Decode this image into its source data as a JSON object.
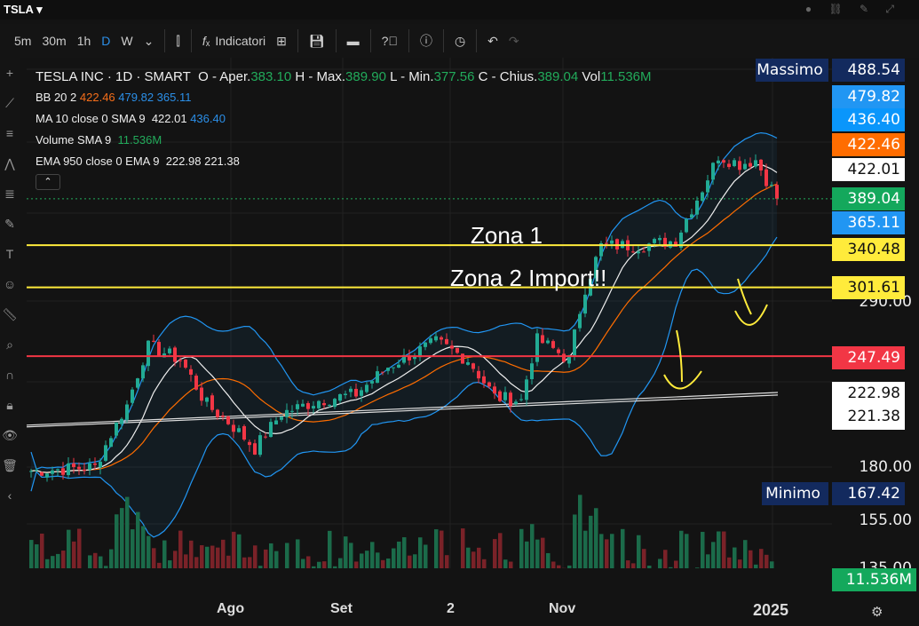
{
  "topbar": {
    "symbol": "TSLA ▾"
  },
  "toolbar": {
    "intervals": [
      "5m",
      "30m",
      "1h",
      "D",
      "W"
    ],
    "active": "D",
    "indicators": "Indicatori"
  },
  "legend": {
    "title": "TESLA INC · 1D · SMART",
    "o_label": "O - Aper.",
    "o": "383.10",
    "h_label": "H - Max.",
    "h": "389.90",
    "l_label": "L - Min.",
    "l": "377.56",
    "c_label": "C - Chius.",
    "c": "389.04",
    "vol_label": "Vol",
    "vol": "11.536M",
    "bb_label": "BB 20 2",
    "bb_mid": "422.46",
    "bb_up": "479.82",
    "bb_lo": "365.11",
    "ma_label": "MA 10 close 0 SMA 9",
    "ma": "422.01",
    "ma_sma": "436.40",
    "volsma_label": "Volume SMA 9",
    "volsma": "11.536M",
    "ema_label": "EMA 950 close 0 EMA 9",
    "ema": "222.98",
    "ema2": "221.38"
  },
  "annotations": {
    "zona1": "Zona 1",
    "zona2": "Zona 2 Import!!"
  },
  "price_labels": {
    "max_tag": "Massimo",
    "max": "488.54",
    "bb_up": "479.82",
    "sma": "436.40",
    "bb_mid": "422.46",
    "ma": "422.01",
    "close": "389.04",
    "bb_lo": "365.11",
    "z1": "340.48",
    "z2": "301.61",
    "red": "247.49",
    "ema": "222.98",
    "ema2": "221.38",
    "min_tag": "Minimo",
    "min": "167.42",
    "vol": "11.536M"
  },
  "price_ticks": [
    "290.00",
    "180.00",
    "155.00",
    "135.00"
  ],
  "time_ticks": [
    "Ago",
    "Set",
    "2",
    "Nov",
    "2025"
  ],
  "colors": {
    "up": "#22ab94",
    "down": "#f23645",
    "yellow": "#ffeb3b",
    "red": "#f23645",
    "blue": "#2196f3",
    "orange": "#ff6d00"
  },
  "chart_data": {
    "type": "candlestick",
    "hlines": [
      340.48,
      301.61,
      247.49
    ],
    "waypoints": [
      [
        0,
        178
      ],
      [
        12,
        180
      ],
      [
        18,
        215
      ],
      [
        22,
        255
      ],
      [
        28,
        245
      ],
      [
        33,
        215
      ],
      [
        37,
        205
      ],
      [
        42,
        190
      ],
      [
        47,
        210
      ],
      [
        54,
        218
      ],
      [
        61,
        222
      ],
      [
        67,
        240
      ],
      [
        76,
        258
      ],
      [
        82,
        245
      ],
      [
        87,
        220
      ],
      [
        92,
        218
      ],
      [
        95,
        260
      ],
      [
        101,
        245
      ],
      [
        104,
        300
      ],
      [
        107,
        340
      ],
      [
        114,
        340
      ],
      [
        121,
        345
      ],
      [
        126,
        400
      ],
      [
        129,
        440
      ],
      [
        133,
        430
      ],
      [
        136,
        435
      ],
      [
        140,
        389
      ]
    ]
  }
}
